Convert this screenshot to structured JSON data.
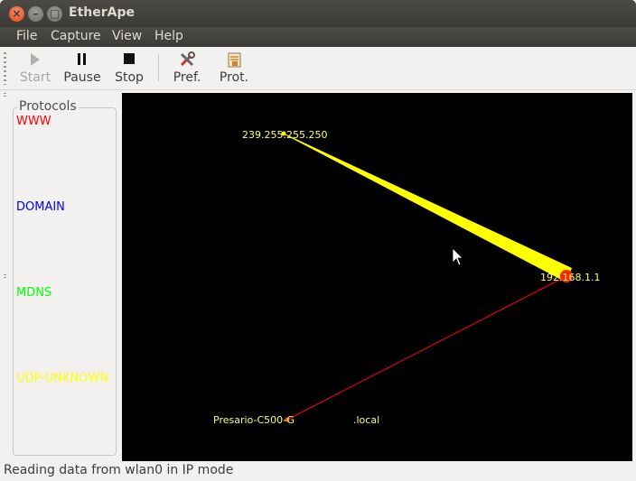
{
  "window": {
    "title": "EtherApe",
    "close_glyph": "×",
    "min_glyph": "–",
    "max_glyph": "□"
  },
  "menu": {
    "items": [
      "File",
      "Capture",
      "View",
      "Help"
    ]
  },
  "toolbar": {
    "start_label": "Start",
    "pause_label": "Pause",
    "stop_label": "Stop",
    "pref_label": "Pref.",
    "prot_label": "Prot."
  },
  "protocols": {
    "title": "Protocols",
    "items": [
      {
        "name": "WWW",
        "color": "#ff0000"
      },
      {
        "name": "DOMAIN",
        "color": "#0000ff"
      },
      {
        "name": "MDNS",
        "color": "#00ff00"
      },
      {
        "name": "UDP-UNKNOWN",
        "color": "#ffff00"
      }
    ]
  },
  "graph": {
    "background": "#000000",
    "label_color": "#ffff66",
    "nodes": [
      {
        "id": "multicast",
        "label": "239.255.255.250"
      },
      {
        "id": "router",
        "label": "192.168.1.1"
      },
      {
        "id": "host",
        "label": "Presario-C500-G",
        "label_suffix": ".local"
      }
    ],
    "links": [
      {
        "from": "multicast",
        "to": "router",
        "protocol": "UDP-UNKNOWN",
        "color": "#ffff00"
      },
      {
        "from": "host",
        "to": "router",
        "protocol": "WWW",
        "color": "#ff0000"
      }
    ]
  },
  "status": {
    "text": "Reading data from wlan0 in IP mode"
  }
}
